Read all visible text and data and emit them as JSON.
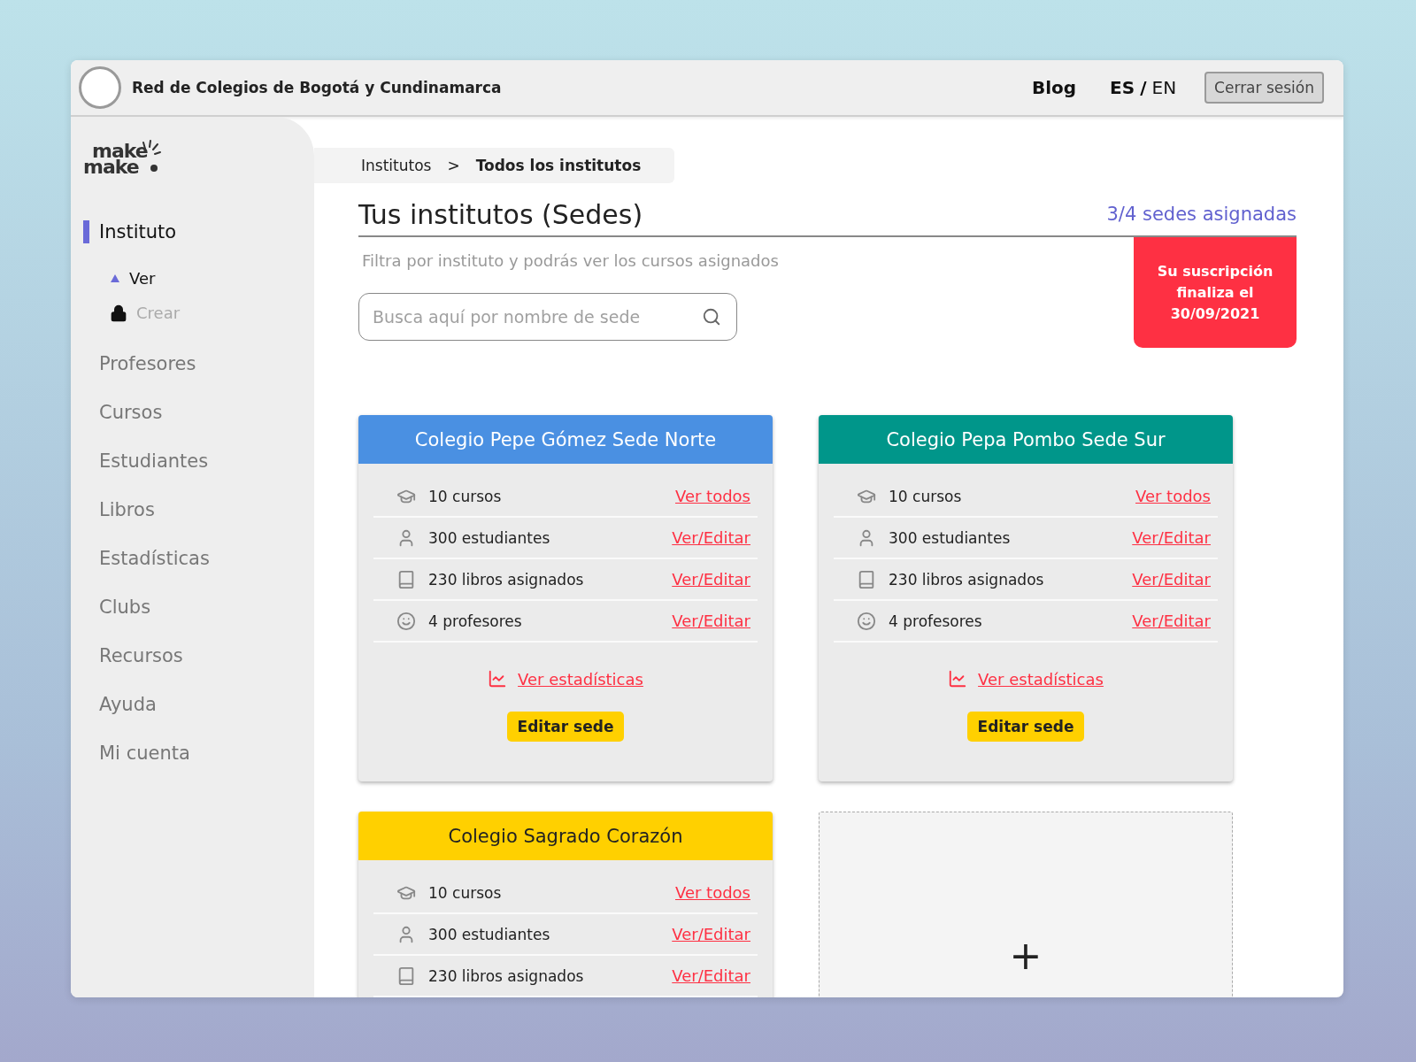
{
  "header": {
    "title": "Red de Colegios de Bogotá y Cundinamarca",
    "nav": [
      {
        "label": "Blog"
      }
    ],
    "languages": [
      {
        "label": "ES",
        "selected": true
      },
      {
        "label": "EN",
        "selected": false
      }
    ],
    "language_separator": "/",
    "logout": "Cerrar sesión"
  },
  "sidebar": {
    "logo": [
      "make",
      "make"
    ],
    "items": [
      {
        "label": "Instituto",
        "selected": true,
        "children": [
          {
            "label": "Ver",
            "kind": "view",
            "disabled": false
          },
          {
            "label": "Crear",
            "kind": "create",
            "disabled": true
          }
        ]
      },
      {
        "label": "Profesores",
        "selected": false
      },
      {
        "label": "Cursos",
        "selected": false
      },
      {
        "label": "Estudiantes",
        "selected": false
      },
      {
        "label": "Libros",
        "selected": false
      },
      {
        "label": "Estadísticas",
        "selected": false
      },
      {
        "label": "Clubs",
        "selected": false
      },
      {
        "label": "Recursos",
        "selected": false
      },
      {
        "label": "Ayuda",
        "selected": false
      },
      {
        "label": "Mi cuenta",
        "selected": false
      }
    ]
  },
  "breadcrumb": {
    "items": [
      "Institutos",
      "Todos los institutos"
    ],
    "separator": ">"
  },
  "title": "Tus institutos (Sedes)",
  "assigned": "3/4 sedes asignadas",
  "subtitle": "Filtra por instituto y podrás ver los cursos asignados",
  "search": {
    "placeholder": "Busca aquí por nombre de sede"
  },
  "subscription_alert": "Su suscripción finaliza el 30/09/2021",
  "cards": [
    {
      "title": "Colegio Pepe Gómez Sede Norte",
      "color": "#4a90e2",
      "rows": [
        {
          "kind": "courses",
          "text": "10 cursos",
          "link": "Ver todos"
        },
        {
          "kind": "students",
          "text": "300 estudiantes",
          "link": "Ver/Editar"
        },
        {
          "kind": "books",
          "text": "230 libros asignados",
          "link": "Ver/Editar"
        },
        {
          "kind": "teachers",
          "text": "4 profesores",
          "link": "Ver/Editar"
        }
      ],
      "stats_link": "Ver estadísticas",
      "button": "Editar sede"
    },
    {
      "title": "Colegio Pepa Pombo Sede Sur",
      "color": "#00968a",
      "rows": [
        {
          "kind": "courses",
          "text": "10 cursos",
          "link": "Ver todos"
        },
        {
          "kind": "students",
          "text": "300 estudiantes",
          "link": "Ver/Editar"
        },
        {
          "kind": "books",
          "text": "230 libros asignados",
          "link": "Ver/Editar"
        },
        {
          "kind": "teachers",
          "text": "4 profesores",
          "link": "Ver/Editar"
        }
      ],
      "stats_link": "Ver estadísticas",
      "button": "Editar sede"
    },
    {
      "title": "Colegio Sagrado Corazón",
      "color": "#ffd000",
      "rows": [
        {
          "kind": "courses",
          "text": "10 cursos",
          "link": "Ver todos"
        },
        {
          "kind": "students",
          "text": "300 estudiantes",
          "link": "Ver/Editar"
        },
        {
          "kind": "books",
          "text": "230 libros asignados",
          "link": "Ver/Editar"
        }
      ]
    }
  ],
  "add_tile": {
    "symbol": "+"
  }
}
